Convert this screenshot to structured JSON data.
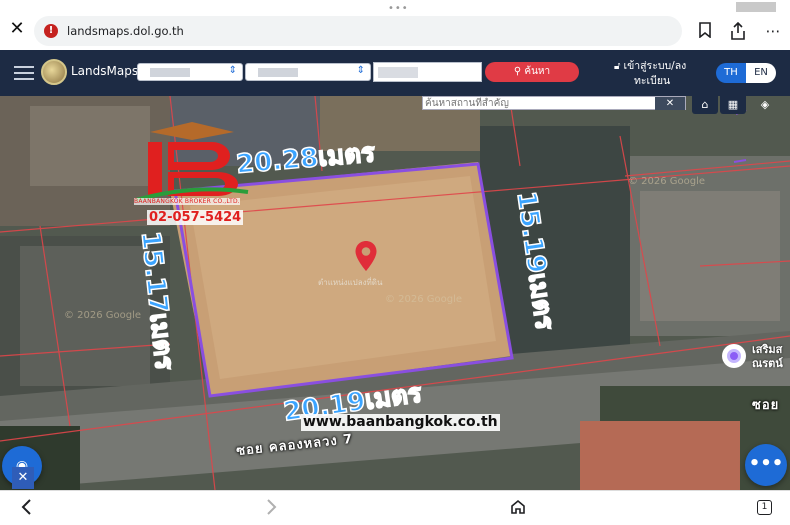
{
  "browser": {
    "url": "landsmaps.dol.go.th",
    "tab_count": "1"
  },
  "app": {
    "name": "LandsMaps",
    "search_button": "ค้นหา",
    "login_line1": "เข้าสู่ระบบ/ลง",
    "login_line2": "ทะเบียน",
    "lang_th": "TH",
    "lang_en": "EN"
  },
  "map": {
    "place_search_placeholder": "ค้นหาสถานที่สำคัญ",
    "copyright_1": "© 2026 Google",
    "copyright_2": "© 2026 Google",
    "copyright_3": "© 2026 Google",
    "pin_label": "ตำแหน่งแปลงที่ดิน",
    "poi_label_line1": "เสริมส",
    "poi_label_line2": "ณรตน์",
    "road_label": "ซอย คลองหลวง 7",
    "road_label_right": "ซอย"
  },
  "dimensions": {
    "top": "20.28เมตร",
    "right": "15.19เมตร",
    "left": "15.17เมตร",
    "bottom": "20.19เมตร"
  },
  "watermark": {
    "company": "BAANBANGKOK BROKER CO.,LTD.",
    "phone": "02-057-5424",
    "website": "www.baanbangkok.co.th"
  },
  "colors": {
    "header_bg": "#1d2b44",
    "search_button": "#e03b45",
    "accent_blue": "#1e6bd6",
    "plot_outline": "#8a4fe0",
    "dimension_text": "#3ba4ff",
    "parcel_lines": "#e0464a"
  }
}
